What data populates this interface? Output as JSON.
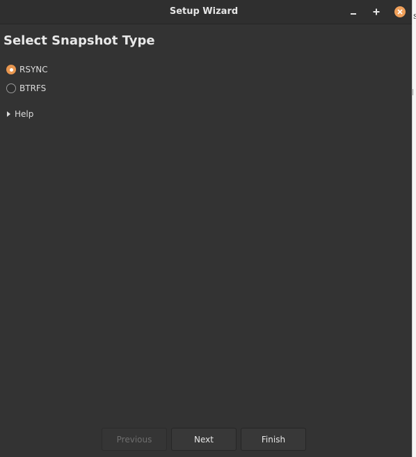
{
  "window": {
    "title": "Setup Wizard",
    "controls": {
      "minimize": "–",
      "maximize": "+",
      "close": "×"
    }
  },
  "page": {
    "heading": "Select Snapshot Type",
    "options": [
      {
        "label": "RSYNC",
        "checked": true
      },
      {
        "label": "BTRFS",
        "checked": false
      }
    ],
    "help_label": "Help"
  },
  "buttons": {
    "previous": "Previous",
    "next": "Next",
    "finish": "Finish"
  },
  "background": {
    "edge_char": "s"
  },
  "colors": {
    "window_bg": "#333333",
    "titlebar_bg": "#2f2f2f",
    "accent": "#e8964f",
    "close_button": "#f0a05a",
    "text": "#e8e8e8",
    "disabled_text": "#6e6e6e"
  }
}
